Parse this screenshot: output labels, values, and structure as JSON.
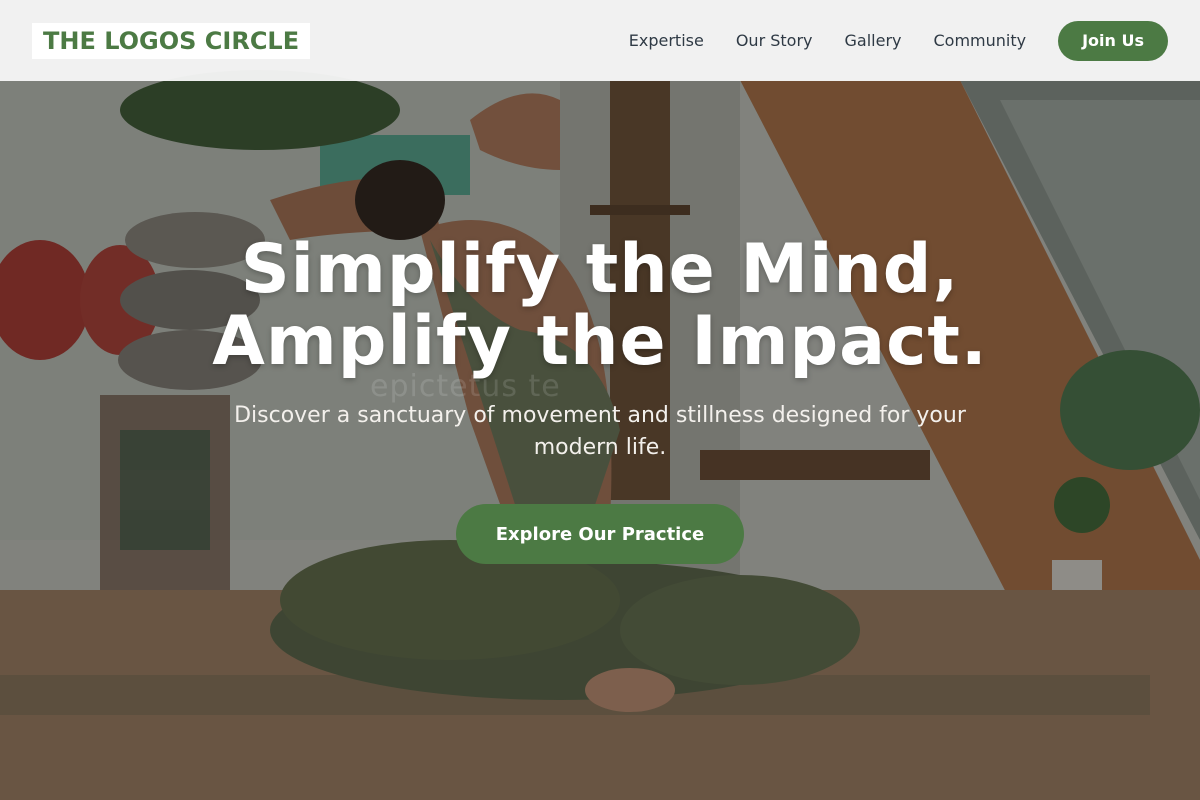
{
  "brand": {
    "name": "THE LOGOS CIRCLE",
    "color": "#4c7a44"
  },
  "nav": {
    "links": [
      {
        "label": "Expertise"
      },
      {
        "label": "Our Story"
      },
      {
        "label": "Gallery"
      },
      {
        "label": "Community"
      }
    ],
    "cta_label": "Join Us"
  },
  "hero": {
    "title_line1": "Simplify the Mind,",
    "title_line2": "Amplify the Impact.",
    "subtitle": "Discover a sanctuary of movement and stillness designed for your modern life.",
    "cta_label": "Explore Our Practice",
    "watermark": "epictetus te"
  },
  "colors": {
    "accent": "#4c7a44",
    "nav_text": "#2f3a45",
    "nav_bg": "#f6f6f6"
  }
}
